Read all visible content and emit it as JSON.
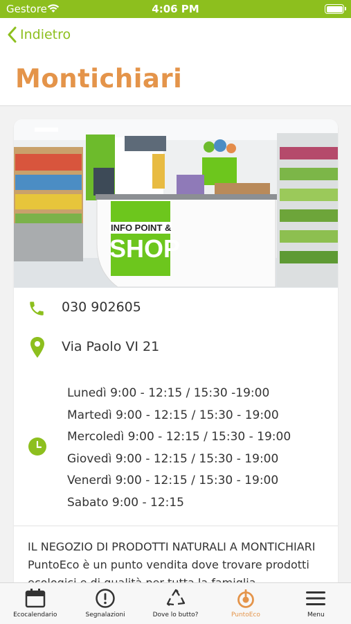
{
  "status_bar": {
    "carrier": "Gestore",
    "time": "4:06 PM"
  },
  "nav": {
    "back_label": "Indietro",
    "title": "Montichiari"
  },
  "photo": {
    "sign_line1": "INFO POINT &",
    "sign_line2": "SHOP"
  },
  "contact": {
    "phone": "030 902605",
    "address": "Via Paolo VI 21",
    "hours": [
      "Lunedì 9:00 - 12:15 / 15:30 -19:00",
      "Martedì 9:00 - 12:15 / 15:30 - 19:00",
      "Mercoledì 9:00 - 12:15 / 15:30 - 19:00",
      "Giovedì 9:00 - 12:15 / 15:30 - 19:00",
      "Venerdì 9:00 - 12:15 / 15:30 - 19:00",
      "Sabato 9:00 - 12:15"
    ]
  },
  "description": {
    "heading": "IL NEGOZIO DI PRODOTTI NATURALI A MONTICHIARI",
    "line2": "PuntoEco è un punto vendita dove trovare prodotti",
    "line3": "ecologici e di qualità per tutta la famiglia."
  },
  "tabs": [
    {
      "label": "Ecocalendario",
      "icon": "calendar-icon"
    },
    {
      "label": "Segnalazioni",
      "icon": "alert-icon"
    },
    {
      "label": "Dove lo butto?",
      "icon": "recycle-icon"
    },
    {
      "label": "PuntoEco",
      "icon": "puntoeco-icon",
      "active": true
    },
    {
      "label": "Menu",
      "icon": "menu-icon"
    }
  ],
  "colors": {
    "green": "#8dbf1e",
    "orange": "#e4944a"
  }
}
